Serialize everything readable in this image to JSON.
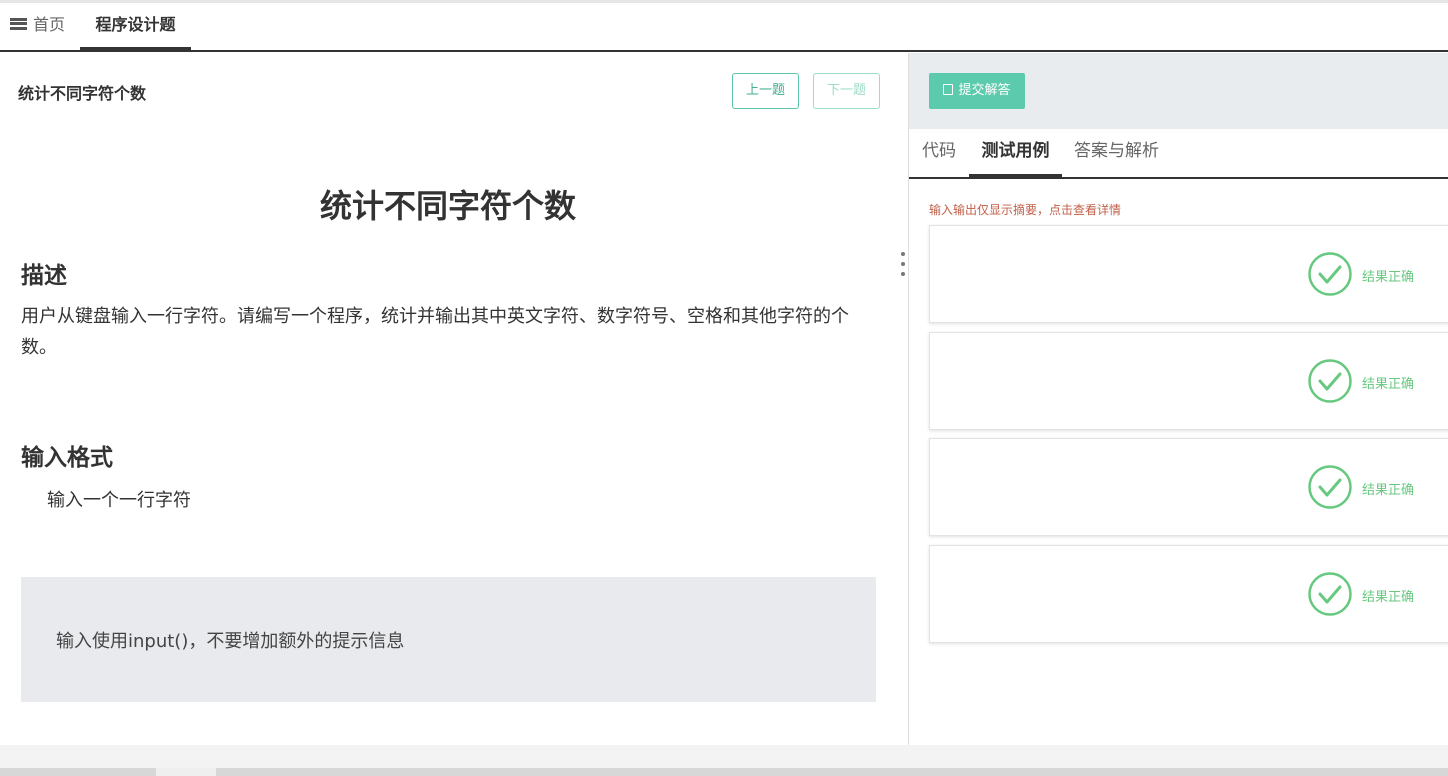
{
  "tabs": {
    "home": "首页",
    "current": "程序设计题"
  },
  "question": {
    "small_title": "统计不同字符个数",
    "prev_label": "上一题",
    "next_label": "下一题",
    "title": "统计不同字符个数",
    "desc_heading": "描述",
    "description": "用户从键盘输入一行字符。请编写一个程序，统计并输出其中英文字符、数字符号、空格和其他字符的个数。",
    "input_heading": "输入格式",
    "input_text": "输入一个一行字符",
    "note": "输入使用input()，不要增加额外的提示信息"
  },
  "right": {
    "submit_label": "提交解答",
    "tabs": [
      "代码",
      "测试用例",
      "答案与解析"
    ],
    "hint": "输入输出仅显示摘要，点击查看详情",
    "cases": [
      {
        "result": "结果正确"
      },
      {
        "result": "结果正确"
      },
      {
        "result": "结果正确"
      },
      {
        "result": "结果正确"
      }
    ]
  },
  "colors": {
    "accent": "#5ccaad",
    "success": "#67c87f",
    "hint": "#c0604a"
  },
  "icons": {
    "menu": "menu-icon",
    "save": "save-icon",
    "check": "check-circle-icon",
    "drag": "drag-handle-icon"
  }
}
